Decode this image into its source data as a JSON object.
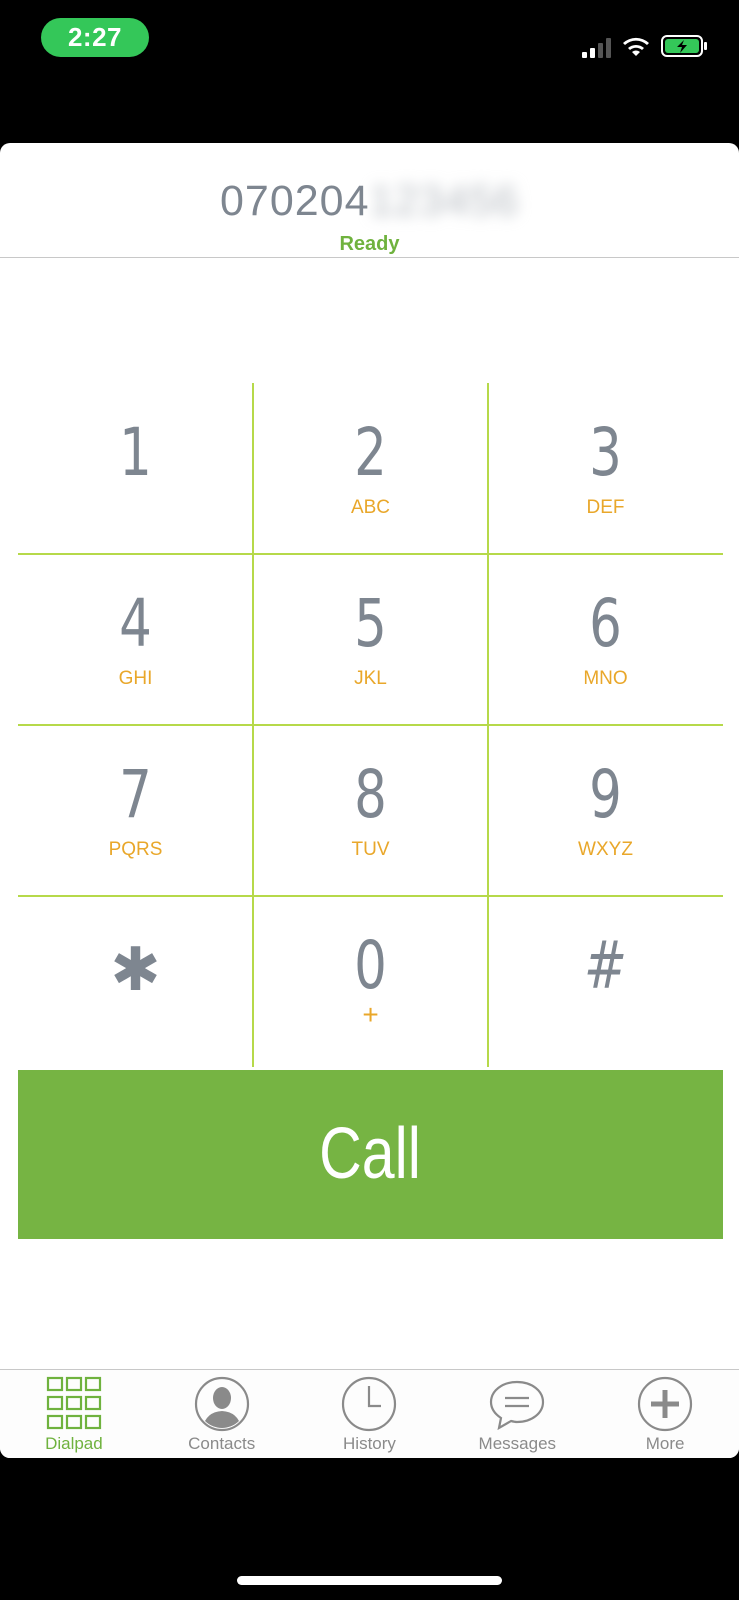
{
  "status_bar": {
    "time": "2:27"
  },
  "dialer": {
    "number_visible": "070204",
    "number_hidden": "123456",
    "status": "Ready",
    "status_color": "#6fb23e"
  },
  "keypad": {
    "keys": [
      {
        "digit": "1",
        "letters": ""
      },
      {
        "digit": "2",
        "letters": "ABC"
      },
      {
        "digit": "3",
        "letters": "DEF"
      },
      {
        "digit": "4",
        "letters": "GHI"
      },
      {
        "digit": "5",
        "letters": "JKL"
      },
      {
        "digit": "6",
        "letters": "MNO"
      },
      {
        "digit": "7",
        "letters": "PQRS"
      },
      {
        "digit": "8",
        "letters": "TUV"
      },
      {
        "digit": "9",
        "letters": "WXYZ"
      },
      {
        "digit": "✱",
        "letters": ""
      },
      {
        "digit": "0",
        "letters": "+"
      },
      {
        "digit": "#",
        "letters": ""
      }
    ],
    "grid_color": "#b6d94a",
    "digit_color": "#7e8690",
    "letters_color": "#e9a72a"
  },
  "call_button": {
    "label": "Call",
    "color": "#76b443"
  },
  "tabbar": {
    "tabs": [
      {
        "label": "Dialpad",
        "icon": "dialpad-grid-icon",
        "active": true
      },
      {
        "label": "Contacts",
        "icon": "contact-person-icon",
        "active": false
      },
      {
        "label": "History",
        "icon": "clock-icon",
        "active": false
      },
      {
        "label": "Messages",
        "icon": "chat-bubble-icon",
        "active": false
      },
      {
        "label": "More",
        "icon": "plus-circle-icon",
        "active": false
      }
    ],
    "active_color": "#6fb23e",
    "inactive_color": "#8a8a8a"
  }
}
